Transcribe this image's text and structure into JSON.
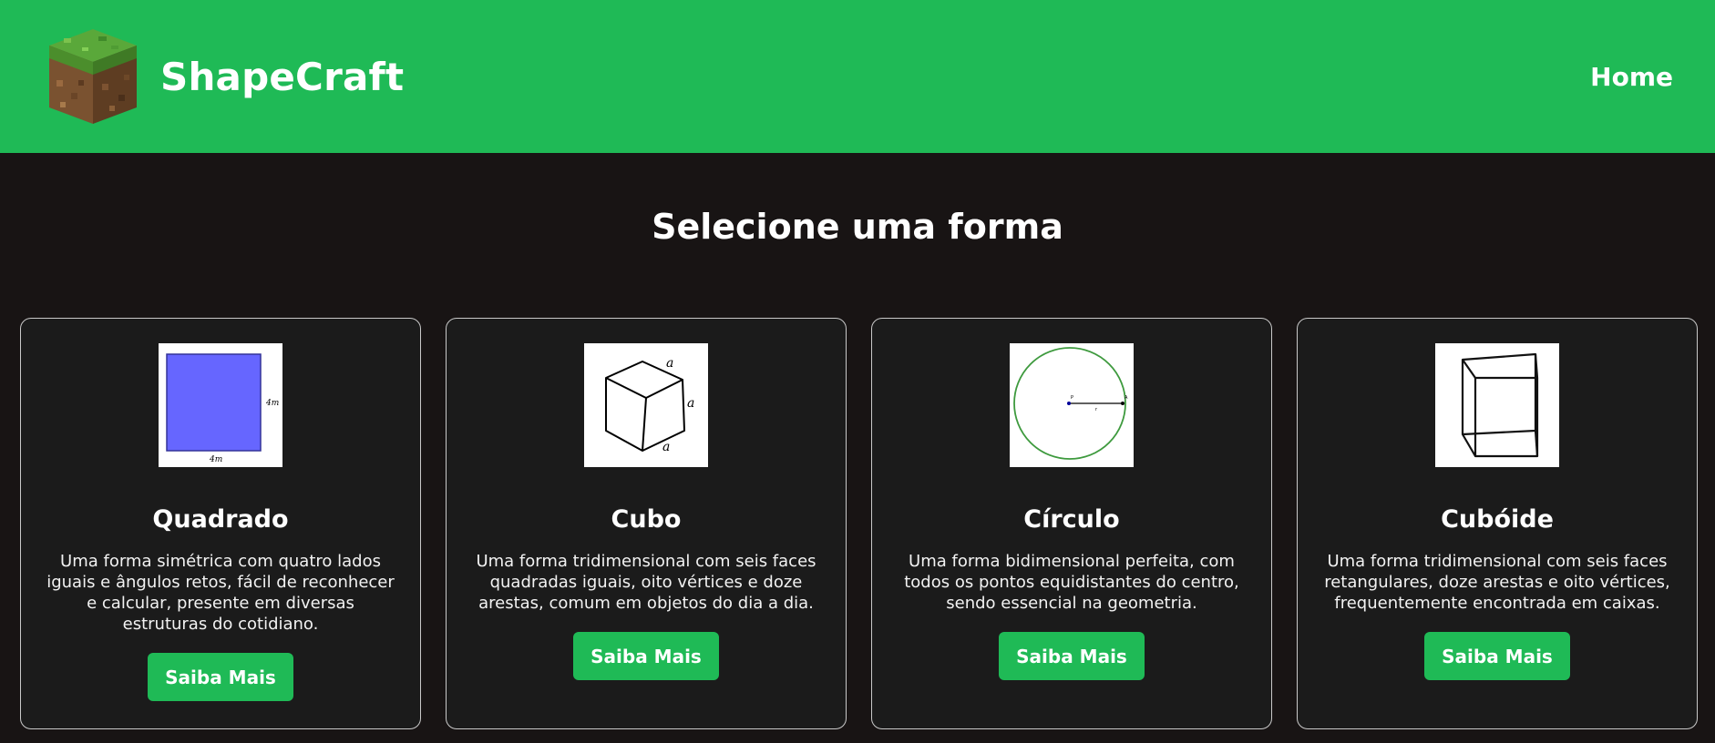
{
  "header": {
    "brand": "ShapeCraft",
    "logo_icon": "grass-block-icon",
    "nav_home": "Home",
    "accent_color": "#1fba56"
  },
  "main": {
    "title": "Selecione uma forma",
    "cards": [
      {
        "title": "Quadrado",
        "text": "Uma forma simétrica com quatro lados iguais e ângulos retos, fácil de reconhecer e calcular, presente em diversas estruturas do cotidiano.",
        "button": "Saiba Mais",
        "image_labels": [
          "4m",
          "4m"
        ]
      },
      {
        "title": "Cubo",
        "text": "Uma forma tridimensional com seis faces quadradas iguais, oito vértices e doze arestas, comum em objetos do dia a dia.",
        "button": "Saiba Mais",
        "image_labels": [
          "a",
          "a",
          "a"
        ]
      },
      {
        "title": "Círculo",
        "text": "Uma forma bidimensional perfeita, com todos os pontos equidistantes do centro, sendo essencial na geometria.",
        "button": "Saiba Mais",
        "image_labels": [
          "P",
          "A",
          "r"
        ]
      },
      {
        "title": "Cubóide",
        "text": "Uma forma tridimensional com seis faces retangulares, doze arestas e oito vértices, frequentemente encontrada em caixas.",
        "button": "Saiba Mais"
      }
    ]
  }
}
